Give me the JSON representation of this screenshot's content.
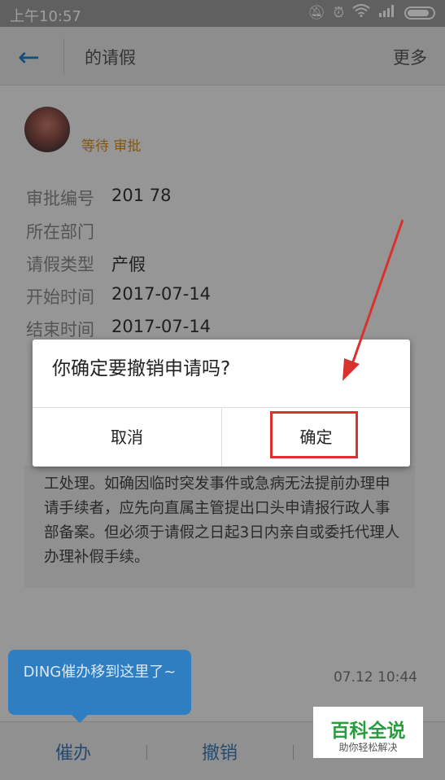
{
  "status_bar": {
    "time": "上午10:57",
    "icons": [
      "alarm-muted-icon",
      "alarm-clock-icon",
      "wifi-icon",
      "signal-icon",
      "battery-icon"
    ]
  },
  "header": {
    "title": "的请假",
    "more_label": "更多"
  },
  "applicant": {
    "name": "",
    "status": "等待 审批"
  },
  "details": [
    {
      "label": "审批编号",
      "value": "201 78"
    },
    {
      "label": "所在部门",
      "value": ""
    },
    {
      "label": "请假类型",
      "value": "产假"
    },
    {
      "label": "开始时间",
      "value": "2017-07-14"
    },
    {
      "label": "结束时间",
      "value": "2017-07-14"
    }
  ],
  "note_text": "工处理。如确因临时突发事件或急病无法提前办理申请手续者，应先向直属主管提出口头申请报行政人事部备案。但必须于请假之日起3日内亲自或委托代理人办理补假手续。",
  "tooltip": {
    "text": "DING催办移到这里了~"
  },
  "comment_time": "07.12 10:44",
  "bottom_bar": {
    "urge_label": "催办",
    "revoke_label": "撤销"
  },
  "dialog": {
    "message": "你确定要撤销申请吗?",
    "cancel_label": "取消",
    "confirm_label": "确定"
  },
  "watermark": {
    "title": "百科全说",
    "subtitle": "助你轻松解决"
  },
  "colors": {
    "accent_blue": "#1a7fc9",
    "annotation_red": "#d9322e",
    "status_orange": "#cf8d2b",
    "watermark_green": "#2a9c3f"
  }
}
